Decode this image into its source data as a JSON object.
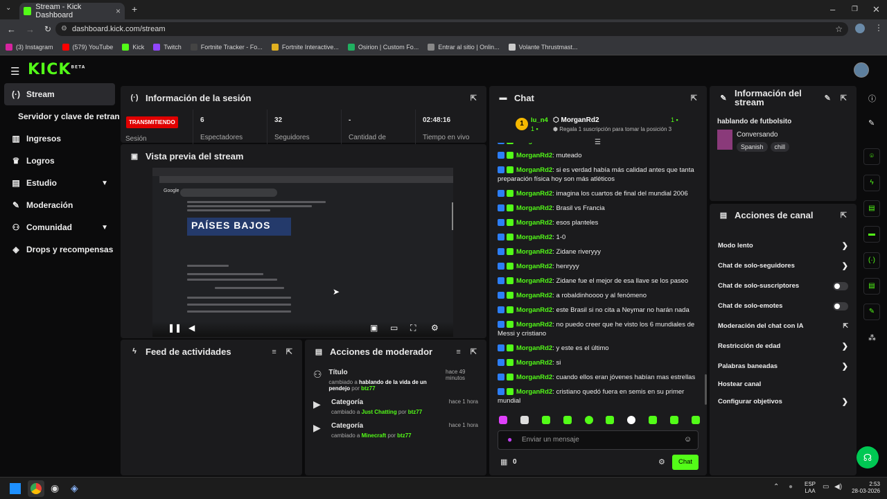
{
  "browser": {
    "tab_title": "Stream - Kick Dashboard",
    "url": "dashboard.kick.com/stream",
    "bookmarks": [
      "(3) Instagram",
      "(579) YouTube",
      "Kick",
      "Twitch",
      "Fortnite Tracker - Fo...",
      "Fortnite Interactive...",
      "Osirion | Custom Fo...",
      "Entrar al sitio | Onlin...",
      "Volante Thrustmast..."
    ]
  },
  "header": {
    "logo": "KICK",
    "beta": "BETA"
  },
  "sidebar": {
    "items": [
      {
        "label": "Stream",
        "icon": "stream-icon"
      },
      {
        "label": "Servidor y clave de retransmisión",
        "icon": ""
      },
      {
        "label": "Ingresos",
        "icon": "income-icon"
      },
      {
        "label": "Logros",
        "icon": "trophy-icon"
      },
      {
        "label": "Estudio",
        "icon": "studio-icon"
      },
      {
        "label": "Moderación",
        "icon": "wrench-icon"
      },
      {
        "label": "Comunidad",
        "icon": "community-icon"
      },
      {
        "label": "Drops y recompensas",
        "icon": "drops-icon"
      }
    ]
  },
  "session": {
    "title": "Información de la sesión",
    "status": "TRANSMITIENDO",
    "status_label": "Sesión",
    "stats": [
      {
        "value": "6",
        "label": "Espectadores"
      },
      {
        "value": "32",
        "label": "Seguidores"
      },
      {
        "value": "-",
        "label": "Cantidad de"
      },
      {
        "value": "02:48:16",
        "label": "Tiempo en vivo"
      }
    ]
  },
  "preview": {
    "title": "Vista previa del stream",
    "card_text": "PAÍSES BAJOS"
  },
  "activity": {
    "title": "Feed de actividades"
  },
  "mod_actions": {
    "title": "Acciones de moderador",
    "items": [
      {
        "type": "Título",
        "time": "hace 49 minutos",
        "prefix": "cambiado a ",
        "value": "hablando de la vida de un pendejo",
        "by": " por ",
        "user": "btz77",
        "value_green": false
      },
      {
        "type": "Categoría",
        "time": "hace 1 hora",
        "prefix": "cambiado a ",
        "value": "Just Chatting",
        "by": " por ",
        "user": "btz77",
        "value_green": true
      },
      {
        "type": "Categoría",
        "time": "hace 1 hora",
        "prefix": "cambiado a ",
        "value": "Minecraft",
        "by": " por ",
        "user": "btz77",
        "value_green": true
      }
    ]
  },
  "chat": {
    "title": "Chat",
    "leader": {
      "rank": "1",
      "user": "lu_n4",
      "count": "1",
      "pinned_user": "MorganRd2",
      "pinned_count": "1",
      "gift_text": "Regala 1 suscripción para tomar la posición 3"
    },
    "messages": [
      {
        "user": "MorganRd2",
        "text": "muteado"
      },
      {
        "user": "MorganRd2",
        "text": "si es verdad había más calidad antes que tanta preparación física hoy son más atléticos"
      },
      {
        "user": "MorganRd2",
        "text": "imagina los cuartos de final del mundial 2006"
      },
      {
        "user": "MorganRd2",
        "text": "Brasil vs Francia"
      },
      {
        "user": "MorganRd2",
        "text": "esos planteles"
      },
      {
        "user": "MorganRd2",
        "text": "1-0"
      },
      {
        "user": "MorganRd2",
        "text": "Zidane riveryyy"
      },
      {
        "user": "MorganRd2",
        "text": "henryyy"
      },
      {
        "user": "MorganRd2",
        "text": "Zidane fue el mejor de esa llave se los paseo"
      },
      {
        "user": "MorganRd2",
        "text": "a robaldinhoooo y al fenómeno"
      },
      {
        "user": "MorganRd2",
        "text": "este Brasil si no cita a Neymar no harán nada"
      },
      {
        "user": "MorganRd2",
        "text": "no puedo creer que he visto los 6 mundiales de Messi y cristiano"
      },
      {
        "user": "MorganRd2",
        "text": "y este es el último"
      },
      {
        "user": "MorganRd2",
        "text": "si"
      },
      {
        "user": "MorganRd2",
        "text": "cuando ellos eran jóvenes habían mas estrellas"
      },
      {
        "user": "MorganRd2",
        "text": "cristiano quedó fuera en semis en su primer mundial"
      }
    ],
    "input_placeholder": "Enviar un mensaje",
    "points": "0",
    "send_label": "Chat"
  },
  "stream_info": {
    "title": "Información del stream",
    "stream_title": "hablando de futbolsito",
    "category": "Conversando",
    "tags": [
      "Spanish",
      "chill"
    ]
  },
  "channel_actions": {
    "title": "Acciones de canal",
    "items": [
      {
        "label": "Modo lento",
        "control": "chevron"
      },
      {
        "label": "Chat de solo-seguidores",
        "control": "chevron"
      },
      {
        "label": "Chat de solo-suscriptores",
        "control": "toggle"
      },
      {
        "label": "Chat de solo-emotes",
        "control": "toggle"
      },
      {
        "label": "Moderación del chat con IA",
        "control": "popout"
      },
      {
        "label": "Restricción de edad",
        "control": "chevron"
      },
      {
        "label": "Palabras baneadas",
        "control": "chevron"
      },
      {
        "label": "Hostear canal",
        "control": "none"
      },
      {
        "label": "Configurar objetivos",
        "control": "chevron"
      }
    ]
  },
  "taskbar": {
    "lang": "ESP",
    "region": "LAA",
    "time": "2:53",
    "date": "28-03-2026"
  },
  "colors": {
    "accent": "#53fc18",
    "live": "#e00000",
    "panel": "#1b1b1d"
  }
}
